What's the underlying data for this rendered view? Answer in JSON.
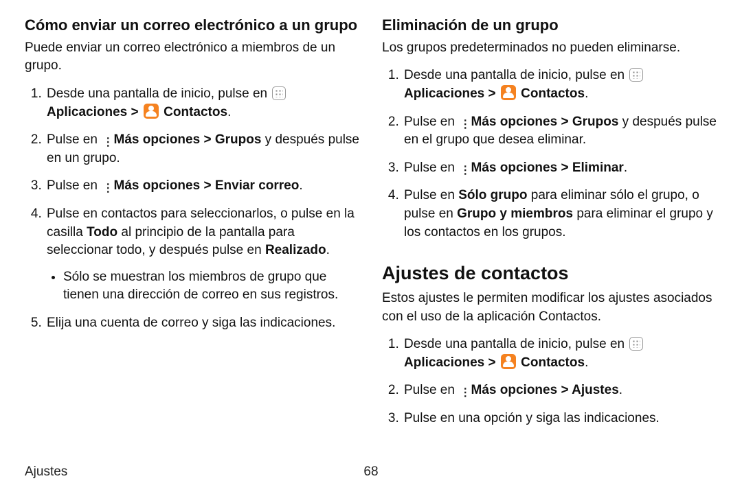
{
  "left": {
    "heading": "Cómo enviar un correo electrónico a un grupo",
    "intro": "Puede enviar un correo electrónico a miembros de un grupo.",
    "step1_a": "Desde una pantalla de inicio, pulse en ",
    "step1_apps": "Aplicaciones",
    "step1_gt": " > ",
    "step1_contacts": "Contactos",
    "step1_dot": ".",
    "step2_a": "Pulse en ",
    "step2_more": "Más opciones",
    "step2_gt": " > ",
    "step2_groups": "Grupos",
    "step2_b": " y después pulse en un grupo.",
    "step3_a": "Pulse en ",
    "step3_more": "Más opciones",
    "step3_gt": " > ",
    "step3_send": "Enviar correo",
    "step3_dot": ".",
    "step4_a": "Pulse en contactos para seleccionarlos, o pulse en la casilla ",
    "step4_todo": "Todo",
    "step4_b": " al principio de la pantalla para seleccionar todo, y después pulse en ",
    "step4_done": "Realizado",
    "step4_dot": ".",
    "step4_sub": "Sólo se muestran los miembros de grupo que tienen una dirección de correo en sus registros.",
    "step5": "Elija una cuenta de correo y siga las indicaciones."
  },
  "rightA": {
    "heading": "Eliminación de un grupo",
    "intro": "Los grupos predeterminados no pueden eliminarse.",
    "step1_a": "Desde una pantalla de inicio, pulse en ",
    "step1_apps": "Aplicaciones",
    "step1_gt": " > ",
    "step1_contacts": "Contactos",
    "step1_dot": ".",
    "step2_a": "Pulse en ",
    "step2_more": "Más opciones",
    "step2_gt": " > ",
    "step2_groups": "Grupos",
    "step2_b": " y después pulse en el grupo que desea eliminar.",
    "step3_a": "Pulse en ",
    "step3_more": "Más opciones",
    "step3_gt": " > ",
    "step3_del": "Eliminar",
    "step3_dot": ".",
    "step4_a": "Pulse en ",
    "step4_only": "Sólo grupo",
    "step4_b": " para eliminar sólo el grupo, o pulse en ",
    "step4_both": "Grupo y miembros",
    "step4_c": " para eliminar el grupo y los contactos en los grupos."
  },
  "rightB": {
    "heading": "Ajustes de contactos",
    "intro": "Estos ajustes le permiten modificar los ajustes asociados con el uso de la aplicación Contactos.",
    "step1_a": "Desde una pantalla de inicio, pulse en ",
    "step1_apps": "Aplicaciones",
    "step1_gt": " > ",
    "step1_contacts": "Contactos",
    "step1_dot": ".",
    "step2_a": "Pulse en ",
    "step2_more": "Más opciones",
    "step2_gt": " > ",
    "step2_settings": "Ajustes",
    "step2_dot": ".",
    "step3": "Pulse en una opción y siga las indicaciones."
  },
  "footer": {
    "left": "Ajustes",
    "page": "68"
  }
}
